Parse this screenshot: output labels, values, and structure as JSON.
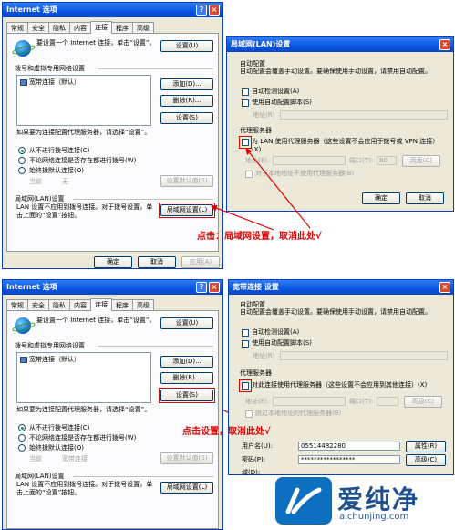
{
  "top": {
    "inet": {
      "title": "Internet 选项",
      "tabs": [
        "常规",
        "安全",
        "隐私",
        "内容",
        "连接",
        "程序",
        "高级"
      ],
      "setup_text": "要设置一个 Internet 连接，单击“设置”。",
      "setup_btn": "设置(U)",
      "dialup_group": "拨号和虚拟专用网络设置",
      "conn_item": "宽带连接（默认）",
      "add_btn": "添加(D)...",
      "remove_btn": "删除(R)...",
      "settings_btn": "设置(S)",
      "proxy_hint": "如果要为连接配置代理服务器，请选择“设置”。",
      "radio1": "从不进行拨号连接(C)",
      "radio2": "不论网络连接是否存在都进行拨号(W)",
      "radio3": "始终拨默认连接(O)",
      "current_label": "当前",
      "current_value": "无",
      "default_btn": "设置默认值(E)",
      "lan_group": "局域网(LAN)设置",
      "lan_desc": "LAN 设置不应用到拨号连接。对于拨号设置，单击上面的“设置”按钮。",
      "lan_btn": "局域网设置(L)",
      "ok": "确定",
      "cancel": "取消",
      "apply": "应用(A)"
    },
    "lan": {
      "title": "局域网(LAN)设置",
      "auto_group": "自动配置",
      "auto_desc": "自动配置会覆盖手动设置。要确保使用手动设置，请禁用自动配置。",
      "auto_detect": "自动检测设置(A)",
      "use_script": "使用自动配置脚本(S)",
      "address_label": "地址(R)",
      "proxy_group": "代理服务器",
      "use_proxy": "为 LAN 使用代理服务器（这些设置不会应用于拨号或 VPN 连接）(X)",
      "addr_label": "地址(E):",
      "port_label": "端口(T):",
      "port_value": "80",
      "advanced_btn": "高级(C)",
      "bypass": "对于本地地址不使用代理服务器(B)",
      "ok": "确定",
      "cancel": "取消"
    },
    "annotation": "点击：局域网设置，取消此处√"
  },
  "bottom": {
    "inet": {
      "title": "Internet 选项",
      "tabs": [
        "常规",
        "安全",
        "隐私",
        "内容",
        "连接",
        "程序",
        "高级"
      ],
      "setup_text": "要设置一个 Internet 连接，单击“设置”。",
      "setup_btn": "设置(U)",
      "dialup_group": "拨号和虚拟专用网络设置",
      "conn_item": "宽带连接（默认）",
      "add_btn": "添加(D)...",
      "remove_btn": "删除(R)...",
      "settings_btn": "设置(S)",
      "proxy_hint": "如果要为连接配置代理服务器，请选择“设置”。",
      "radio1": "从不进行拨号连接(C)",
      "radio2": "不论网络连接是否存在都进行拨号(W)",
      "radio3": "始终拨默认连接(O)",
      "current_label": "当前",
      "current_value": "宽带连接",
      "default_btn": "设置默认值(E)",
      "lan_group": "局域网(LAN)设置",
      "lan_desc": "LAN 设置不应用到拨号连接。对于拨号设置，单击上面的“设置”按钮。",
      "lan_btn": "局域网设置(L)"
    },
    "dialup": {
      "title": "宽带连接 设置",
      "auto_group": "自动配置",
      "auto_desc": "自动配置会覆盖手动设置。要确保使用手动设置，请禁用自动配置。",
      "auto_detect": "自动检测设置(A)",
      "use_script": "使用自动配置脚本(S)",
      "address_label": "地址(R)",
      "proxy_group": "代理服务器",
      "use_proxy": "对此连接使用代理服务器（这些设置不会应用到其他连接）(X)",
      "addr_label": "地址(E):",
      "port_label": "端口(T):",
      "bypass": "跳过本地地址的代理服务器(B)",
      "user_label": "用户名(U):",
      "user_value": "05514482280",
      "pass_label": "密码(P):",
      "pass_value": "*****************",
      "domain_label": "域(D):",
      "props_btn": "属性(R)",
      "advanced_btn": "高级(C)"
    },
    "annotation": "点击设置，取消此处√"
  },
  "brand": {
    "logo_text": "爱纯净",
    "url": "aichunjing.com"
  }
}
